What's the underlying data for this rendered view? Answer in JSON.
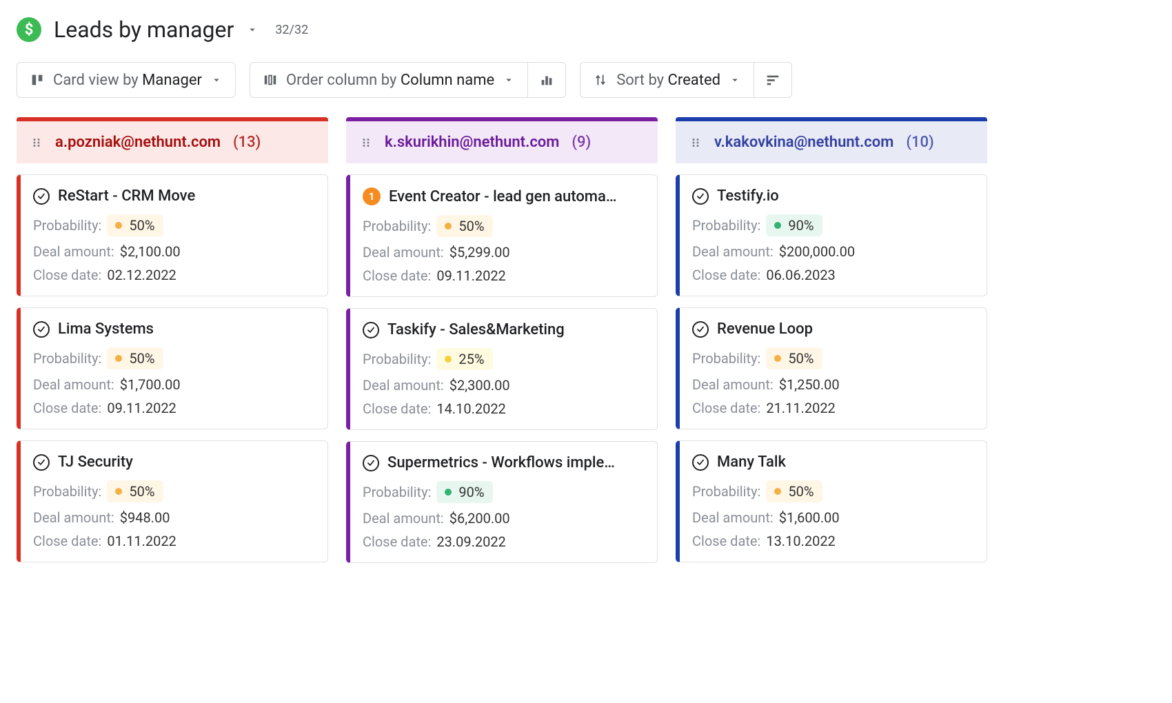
{
  "header": {
    "title": "Leads by manager",
    "counter": "32/32"
  },
  "toolbar": {
    "cardview_prefix": "Card view by ",
    "cardview_value": "Manager",
    "order_prefix": "Order column by ",
    "order_value": "Column name",
    "sort_prefix": "Sort by ",
    "sort_value": "Created"
  },
  "labels": {
    "probability": "Probability:",
    "deal_amount": "Deal amount:",
    "close_date": "Close date:"
  },
  "columns": [
    {
      "id": "col-red",
      "colorClass": "col-red",
      "manager": "a.pozniak@nethunt.com",
      "count": "(13)",
      "cards": [
        {
          "status": "check",
          "title": "ReStart - CRM Move",
          "probability": "50%",
          "probClass": "",
          "amount": "$2,100.00",
          "close": "02.12.2022"
        },
        {
          "status": "check",
          "title": "Lima Systems",
          "probability": "50%",
          "probClass": "",
          "amount": "$1,700.00",
          "close": "09.11.2022"
        },
        {
          "status": "check",
          "title": "TJ Security",
          "probability": "50%",
          "probClass": "",
          "amount": "$948.00",
          "close": "01.11.2022"
        }
      ]
    },
    {
      "id": "col-purple",
      "colorClass": "col-purple",
      "manager": "k.skurikhin@nethunt.com",
      "count": "(9)",
      "cards": [
        {
          "status": "badge",
          "badge": "1",
          "title": "Event Creator - lead gen automa…",
          "probability": "50%",
          "probClass": "",
          "amount": "$5,299.00",
          "close": "09.11.2022"
        },
        {
          "status": "check",
          "title": "Taskify - Sales&Marketing",
          "probability": "25%",
          "probClass": "yellow",
          "amount": "$2,300.00",
          "close": "14.10.2022"
        },
        {
          "status": "check",
          "title": "Supermetrics - Workflows imple…",
          "probability": "90%",
          "probClass": "green",
          "amount": "$6,200.00",
          "close": "23.09.2022"
        }
      ]
    },
    {
      "id": "col-blue",
      "colorClass": "col-blue",
      "manager": "v.kakovkina@nethunt.com",
      "count": "(10)",
      "cards": [
        {
          "status": "check",
          "title": "Testify.io",
          "probability": "90%",
          "probClass": "green",
          "amount": "$200,000.00",
          "close": "06.06.2023"
        },
        {
          "status": "check",
          "title": "Revenue Loop",
          "probability": "50%",
          "probClass": "",
          "amount": "$1,250.00",
          "close": "21.11.2022"
        },
        {
          "status": "check",
          "title": "Many Talk",
          "probability": "50%",
          "probClass": "",
          "amount": "$1,600.00",
          "close": "13.10.2022"
        }
      ]
    }
  ]
}
